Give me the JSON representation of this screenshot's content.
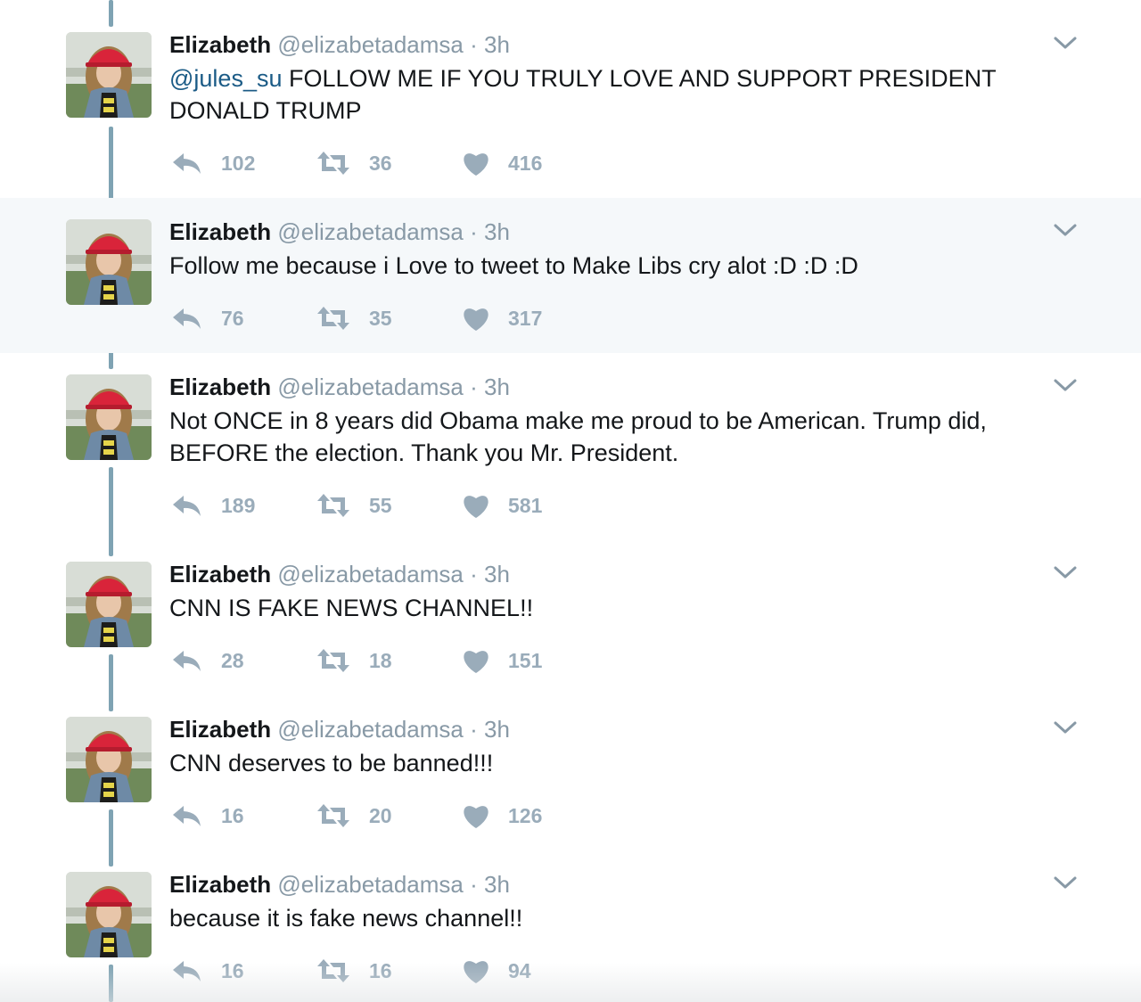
{
  "tweets": [
    {
      "name": "Elizabeth",
      "handle": "@elizabetadamsa",
      "separator": "·",
      "time": "3h",
      "mention": "@jules_su",
      "text": " FOLLOW ME IF YOU TRULY LOVE AND SUPPORT PRESIDENT DONALD TRUMP",
      "replies": "102",
      "retweets": "36",
      "likes": "416"
    },
    {
      "name": "Elizabeth",
      "handle": "@elizabetadamsa",
      "separator": "·",
      "time": "3h",
      "mention": "",
      "text": "Follow me because i Love to tweet to Make Libs cry alot :D :D :D",
      "replies": "76",
      "retweets": "35",
      "likes": "317"
    },
    {
      "name": "Elizabeth",
      "handle": "@elizabetadamsa",
      "separator": "·",
      "time": "3h",
      "mention": "",
      "text": "Not ONCE in 8 years did Obama make me proud to be American. Trump did, BEFORE the election. Thank you Mr. President.",
      "replies": "189",
      "retweets": "55",
      "likes": "581"
    },
    {
      "name": "Elizabeth",
      "handle": "@elizabetadamsa",
      "separator": "·",
      "time": "3h",
      "mention": "",
      "text": "CNN IS FAKE NEWS CHANNEL!!",
      "replies": "28",
      "retweets": "18",
      "likes": "151"
    },
    {
      "name": "Elizabeth",
      "handle": "@elizabetadamsa",
      "separator": "·",
      "time": "3h",
      "mention": "",
      "text": "CNN deserves to be banned!!!",
      "replies": "16",
      "retweets": "20",
      "likes": "126"
    },
    {
      "name": "Elizabeth",
      "handle": "@elizabetadamsa",
      "separator": "·",
      "time": "3h",
      "mention": "",
      "text": "because it is fake news channel!!",
      "replies": "16",
      "retweets": "16",
      "likes": "94"
    }
  ],
  "icons": {
    "reply": "reply-icon",
    "retweet": "retweet-icon",
    "like": "heart-icon",
    "menu": "chevron-down-icon"
  },
  "colors": {
    "thread_line": "#7fa3b3",
    "action_gray": "#9aacba",
    "meta_gray": "#8899a6",
    "mention_blue": "#1b5b86",
    "highlight_bg": "#f5f8fa"
  }
}
